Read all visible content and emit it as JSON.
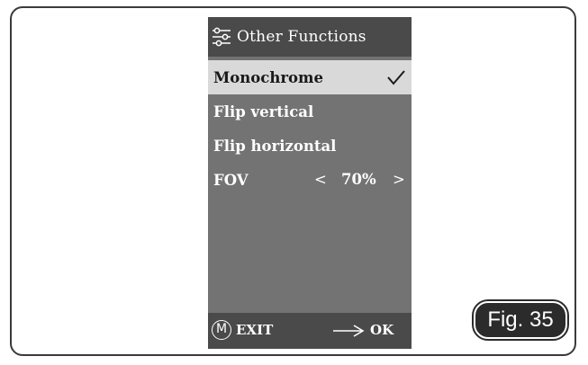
{
  "screen": {
    "title": "Other Functions",
    "title_icon": "sliders-icon"
  },
  "menu": {
    "items": [
      {
        "label": "Monochrome",
        "selected": true,
        "checked": true
      },
      {
        "label": "Flip vertical",
        "selected": false,
        "checked": false
      },
      {
        "label": "Flip horizontal",
        "selected": false,
        "checked": false
      }
    ],
    "fov": {
      "label": "FOV",
      "decrement": "<",
      "value": "70%",
      "increment": ">"
    }
  },
  "footer": {
    "menu_key": "M",
    "exit_label": "EXIT",
    "ok_label": "OK"
  },
  "figure_label": "Fig. 35",
  "colors": {
    "screen_bg": "#737373",
    "bar_bg": "#4a4a4a",
    "selected_bg": "#d9d9d9",
    "badge_bg": "#2b2b2b"
  }
}
